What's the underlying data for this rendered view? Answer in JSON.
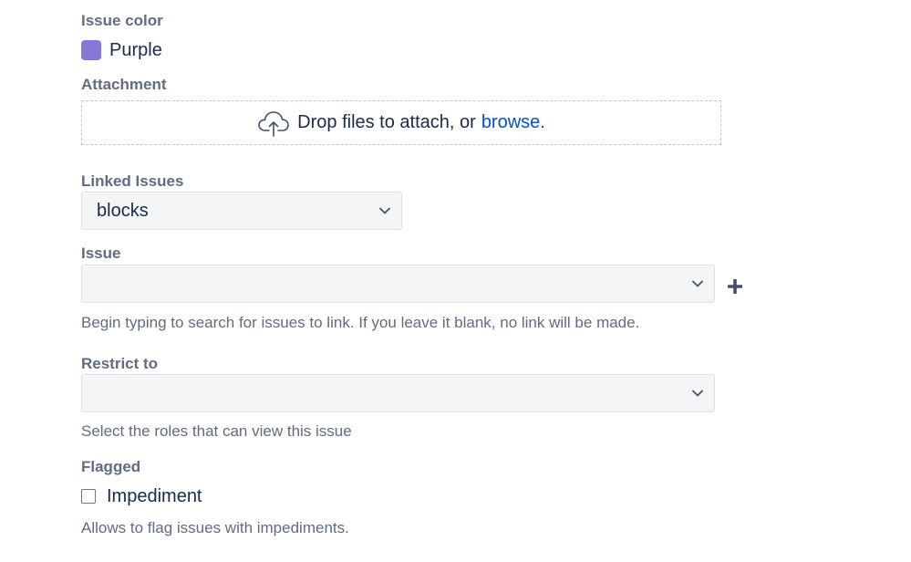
{
  "issue_color": {
    "label": "Issue color",
    "value": "Purple",
    "swatch_color": "#8777d9"
  },
  "attachment": {
    "label": "Attachment",
    "drop_text": "Drop files to attach, or",
    "browse_link": "browse.",
    "icon": "cloud-upload-icon"
  },
  "linked_issues": {
    "label": "Linked Issues",
    "selected": "blocks",
    "icon": "chevron-down-icon"
  },
  "issue": {
    "label": "Issue",
    "selected": "",
    "help": "Begin typing to search for issues to link. If you leave it blank, no link will be made.",
    "add_icon": "plus-icon"
  },
  "restrict_to": {
    "label": "Restrict to",
    "selected": "",
    "help": "Select the roles that can view this issue"
  },
  "flagged": {
    "label": "Flagged",
    "option": "Impediment",
    "checked": false,
    "help": "Allows to flag issues with impediments."
  }
}
